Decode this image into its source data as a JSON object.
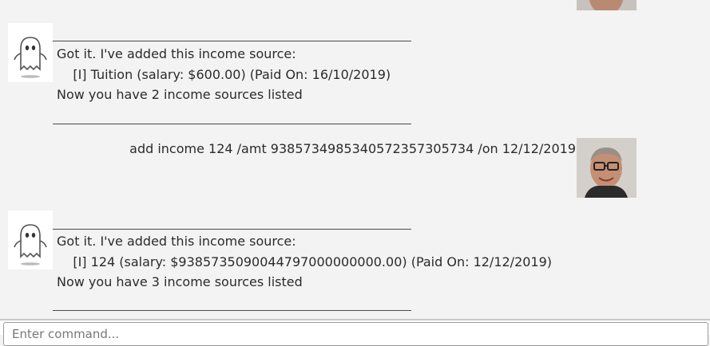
{
  "messages": [
    {
      "sender": "bot",
      "avatar": "ghost-icon",
      "divider": "________________________________________________________",
      "lines": [
        "Got it. I've added this income source:",
        "    [I] Tuition (salary: $600.00) (Paid On: 16/10/2019)",
        "Now you have 2 income sources listed"
      ]
    },
    {
      "sender": "user",
      "avatar": "user-photo",
      "text": "add income 124 /amt 938573498534057235730573​4 /on 12/12/2019"
    },
    {
      "sender": "bot",
      "avatar": "ghost-icon",
      "divider": "________________________________________________________",
      "lines": [
        "Got it. I've added this income source:",
        "    [I] 124 (salary: $938573509004479700000000​0.00) (Paid On: 12/12/2019)",
        "Now you have 3 income sources listed"
      ]
    }
  ],
  "input": {
    "placeholder": "Enter command..."
  }
}
